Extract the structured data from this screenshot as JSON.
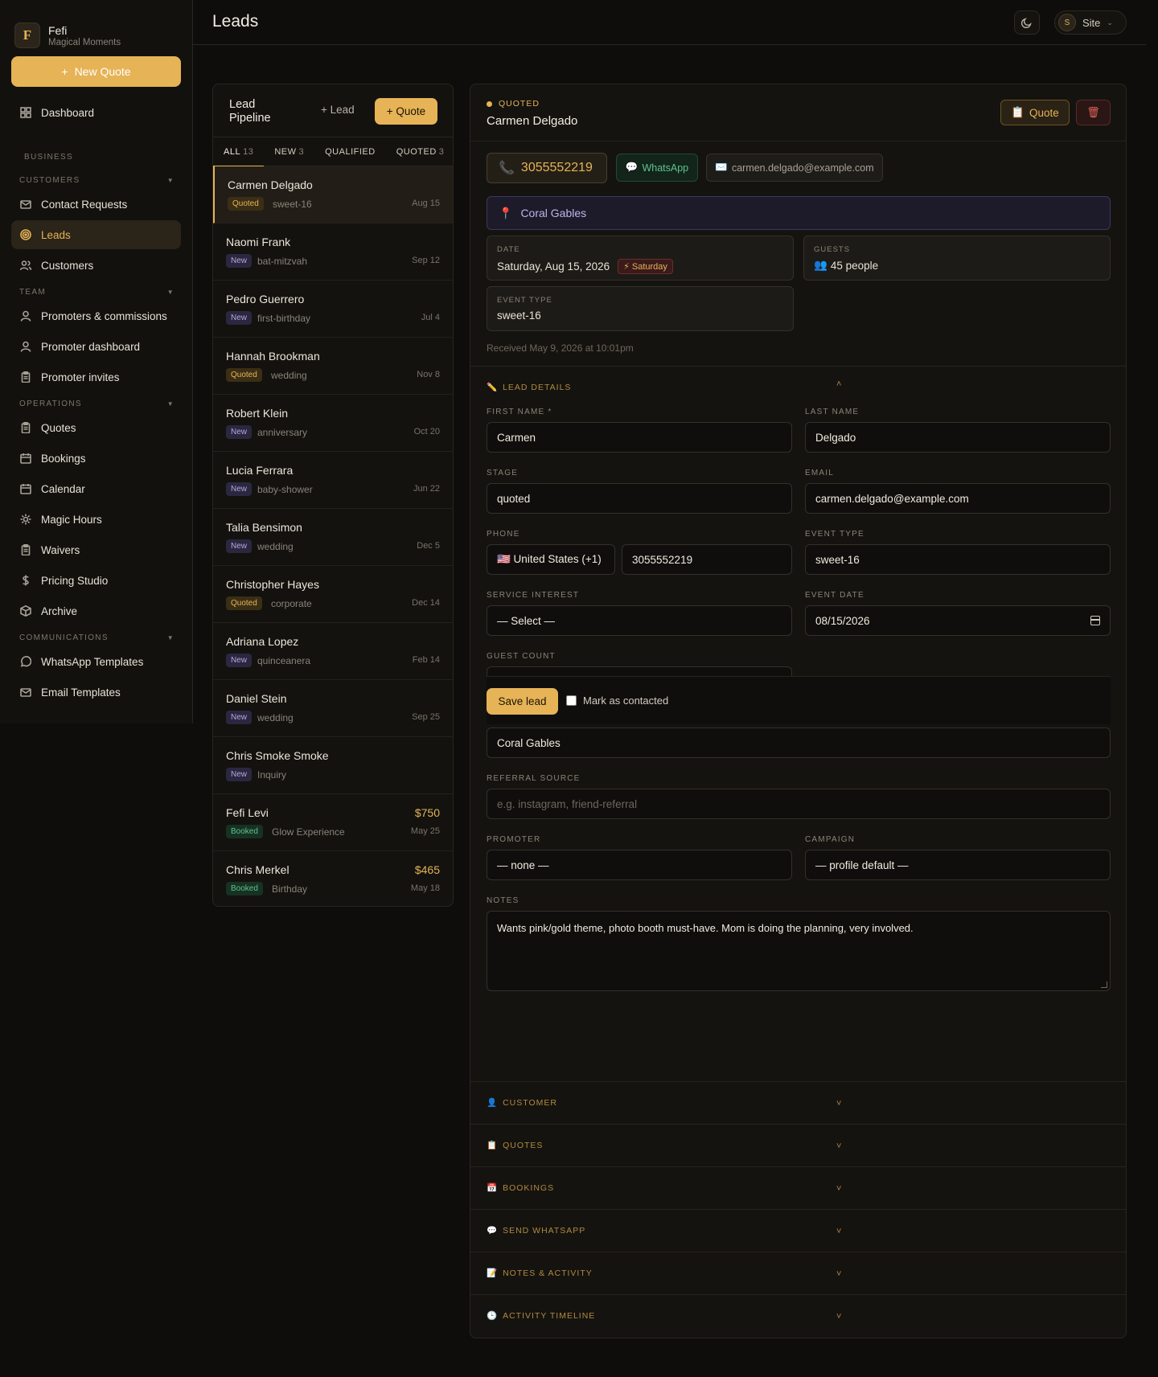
{
  "brand": {
    "logo_letter": "F",
    "name": "Fefi",
    "subtitle": "Magical Moments"
  },
  "sidebar": {
    "new_quote_label": "New Quote",
    "dashboard_label": "Dashboard",
    "business_label": "BUSINESS",
    "customers_group": "CUSTOMERS",
    "contact_requests": "Contact Requests",
    "leads": "Leads",
    "customers": "Customers",
    "team_group": "TEAM",
    "promoters": "Promoters & commissions",
    "promoter_dashboard": "Promoter dashboard",
    "promoter_invites": "Promoter invites",
    "operations_group": "OPERATIONS",
    "quotes": "Quotes",
    "bookings": "Bookings",
    "calendar": "Calendar",
    "magic_hours": "Magic Hours",
    "waivers": "Waivers",
    "pricing_studio": "Pricing Studio",
    "archive": "Archive",
    "communications_group": "COMMUNICATIONS",
    "whatsapp_templates": "WhatsApp Templates",
    "email_templates": "Email Templates"
  },
  "header": {
    "title": "Leads",
    "site_avatar": "S",
    "site_label": "Site"
  },
  "pipeline": {
    "title": "Lead Pipeline",
    "add_lead": "+ Lead",
    "add_quote": "+ Quote",
    "tabs": [
      {
        "label": "ALL",
        "count": "13"
      },
      {
        "label": "NEW",
        "count": "3"
      },
      {
        "label": "QUALIFIED",
        "count": ""
      },
      {
        "label": "QUOTED",
        "count": "3"
      }
    ],
    "leads": [
      {
        "name": "Carmen Delgado",
        "badge": "Quoted",
        "type": "sweet-16",
        "date": "Aug 15",
        "amount": ""
      },
      {
        "name": "Naomi Frank",
        "badge": "New",
        "type": "bat-mitzvah",
        "date": "Sep 12",
        "amount": ""
      },
      {
        "name": "Pedro Guerrero",
        "badge": "New",
        "type": "first-birthday",
        "date": "Jul 4",
        "amount": ""
      },
      {
        "name": "Hannah Brookman",
        "badge": "Quoted",
        "type": "wedding",
        "date": "Nov 8",
        "amount": ""
      },
      {
        "name": "Robert Klein",
        "badge": "New",
        "type": "anniversary",
        "date": "Oct 20",
        "amount": ""
      },
      {
        "name": "Lucia Ferrara",
        "badge": "New",
        "type": "baby-shower",
        "date": "Jun 22",
        "amount": ""
      },
      {
        "name": "Talia Bensimon",
        "badge": "New",
        "type": "wedding",
        "date": "Dec 5",
        "amount": ""
      },
      {
        "name": "Christopher Hayes",
        "badge": "Quoted",
        "type": "corporate",
        "date": "Dec 14",
        "amount": ""
      },
      {
        "name": "Adriana Lopez",
        "badge": "New",
        "type": "quinceanera",
        "date": "Feb 14",
        "amount": ""
      },
      {
        "name": "Daniel Stein",
        "badge": "New",
        "type": "wedding",
        "date": "Sep 25",
        "amount": ""
      },
      {
        "name": "Chris Smoke Smoke",
        "badge": "New",
        "type": "Inquiry",
        "date": "",
        "amount": ""
      },
      {
        "name": "Fefi Levi",
        "badge": "Booked",
        "type": "Glow Experience",
        "date": "May 25",
        "amount": "$750"
      },
      {
        "name": "Chris Merkel",
        "badge": "Booked",
        "type": "Birthday",
        "date": "May 18",
        "amount": "$465"
      }
    ]
  },
  "detail": {
    "stage_label": "QUOTED",
    "name": "Carmen Delgado",
    "quote_btn": "Quote",
    "phone": "3055552219",
    "whatsapp": "WhatsApp",
    "email": "carmen.delgado@example.com",
    "location": "Coral Gables",
    "date_label": "DATE",
    "date_value": "Saturday, Aug 15, 2026",
    "date_badge": "⚡ Saturday",
    "guests_label": "GUESTS",
    "guests_value": "45 people",
    "event_type_label": "EVENT TYPE",
    "event_type_value": "sweet-16",
    "received": "Received May 9, 2026 at 10:01pm",
    "lead_details_title": "LEAD DETAILS",
    "form": {
      "first_name_label": "FIRST NAME *",
      "first_name": "Carmen",
      "last_name_label": "LAST NAME",
      "last_name": "Delgado",
      "stage_label": "STAGE",
      "stage": "quoted",
      "email_label": "EMAIL",
      "email": "carmen.delgado@example.com",
      "phone_label": "PHONE",
      "country": "🇺🇸 United States (+1)",
      "phone": "3055552219",
      "event_type_label": "EVENT TYPE",
      "event_type": "sweet-16",
      "service_interest_label": "SERVICE INTEREST",
      "service_interest": "— Select —",
      "event_date_label": "EVENT DATE",
      "event_date": "08/15/2026",
      "guest_count_label": "GUEST COUNT",
      "location": "Coral Gables",
      "referral_label": "REFERRAL SOURCE",
      "referral_placeholder": "e.g. instagram, friend-referral",
      "promoter_label": "PROMOTER",
      "promoter": "— none —",
      "campaign_label": "CAMPAIGN",
      "campaign": "— profile default —",
      "notes_label": "NOTES",
      "notes": "Wants pink/gold theme, photo booth must-have. Mom is doing the planning, very involved."
    },
    "save_label": "Save lead",
    "mark_contacted": "Mark as contacted",
    "sections": [
      {
        "icon": "👤",
        "title": "CUSTOMER"
      },
      {
        "icon": "📋",
        "title": "QUOTES"
      },
      {
        "icon": "📅",
        "title": "BOOKINGS"
      },
      {
        "icon": "💬",
        "title": "SEND WHATSAPP"
      },
      {
        "icon": "📝",
        "title": "NOTES & ACTIVITY"
      },
      {
        "icon": "🕒",
        "title": "ACTIVITY TIMELINE"
      }
    ]
  },
  "colors": {
    "accent": "#e6b356",
    "background": "#0e0d0b",
    "new_badge": "#b3aad8",
    "booked_badge": "#5fc48a",
    "danger": "#e0645a"
  }
}
